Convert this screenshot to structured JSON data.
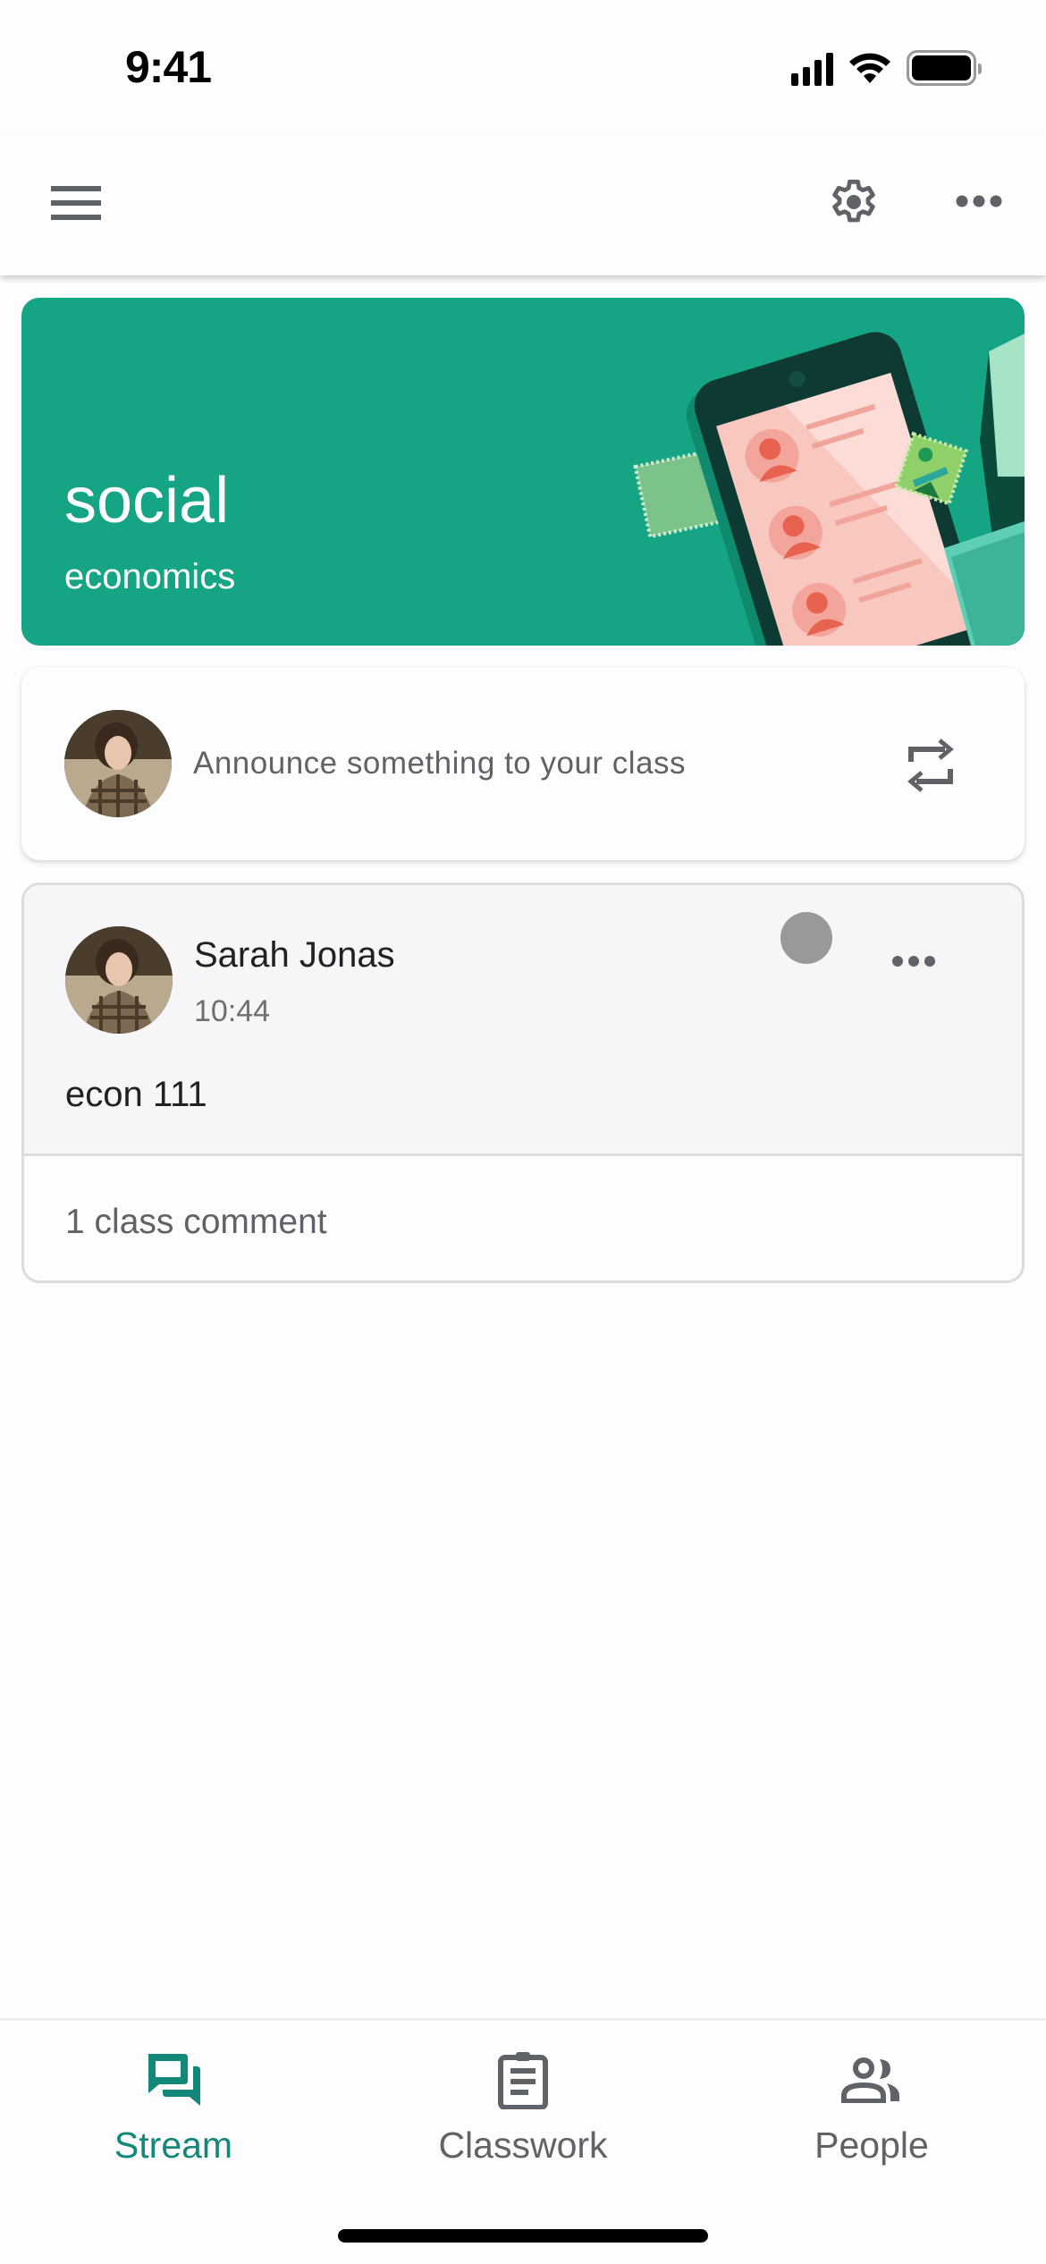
{
  "status_bar": {
    "time": "9:41",
    "icons": [
      "cellular-signal-icon",
      "wifi-icon",
      "battery-icon"
    ]
  },
  "app_bar": {
    "icons": [
      "menu-icon",
      "settings-gear-icon",
      "more-horizontal-icon"
    ]
  },
  "banner": {
    "title": "social",
    "subtitle": "economics",
    "color": "#15a585"
  },
  "announce": {
    "placeholder": "Announce something to your class",
    "icon": "repost-icon"
  },
  "post": {
    "author": "Sarah Jonas",
    "time": "10:44",
    "body": "econ 111",
    "comments_label": "1 class comment"
  },
  "bottom_nav": {
    "items": [
      {
        "label": "Stream",
        "icon": "stream-chat-icon",
        "active": true
      },
      {
        "label": "Classwork",
        "icon": "clipboard-icon",
        "active": false
      },
      {
        "label": "People",
        "icon": "people-icon",
        "active": false
      }
    ],
    "active_color": "#12877a",
    "inactive_color": "#5f6368"
  }
}
